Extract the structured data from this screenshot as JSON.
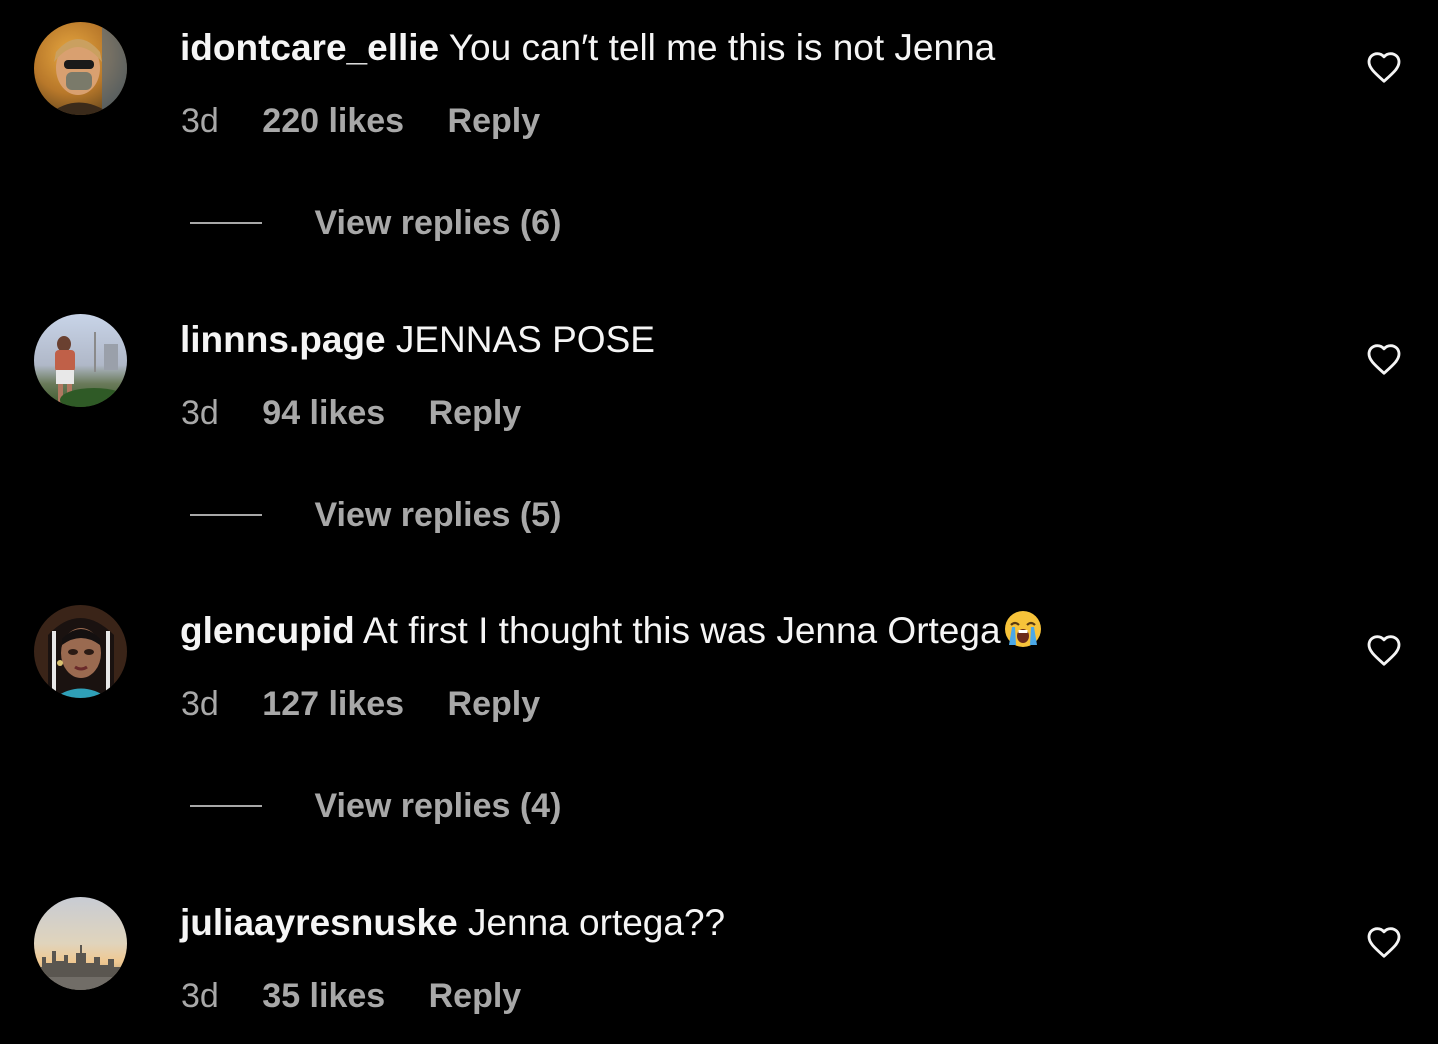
{
  "colors": {
    "background": "#000000",
    "primary_text": "#f5f5f5",
    "secondary_text": "#a8a8a8"
  },
  "comments": [
    {
      "username": "idontcare_ellie",
      "text": "You can′t tell me this is not Jenna",
      "age": "3d",
      "likes": "220 likes",
      "reply": "Reply",
      "view_replies": "View replies (6)",
      "like_icon": "heart-outline-icon"
    },
    {
      "username": "linnns.page",
      "text": "JENNAS POSE",
      "age": "3d",
      "likes": "94 likes",
      "reply": "Reply",
      "view_replies": "View replies (5)",
      "like_icon": "heart-outline-icon"
    },
    {
      "username": "glencupid",
      "text": "At first I thought this was Jenna Ortega",
      "emoji": "loudly-crying-face-emoji",
      "age": "3d",
      "likes": "127 likes",
      "reply": "Reply",
      "view_replies": "View replies (4)",
      "like_icon": "heart-outline-icon"
    },
    {
      "username": "juliaayresnuske",
      "text": "Jenna ortega??",
      "age": "3d",
      "likes": "35 likes",
      "reply": "Reply",
      "like_icon": "heart-outline-icon"
    }
  ]
}
